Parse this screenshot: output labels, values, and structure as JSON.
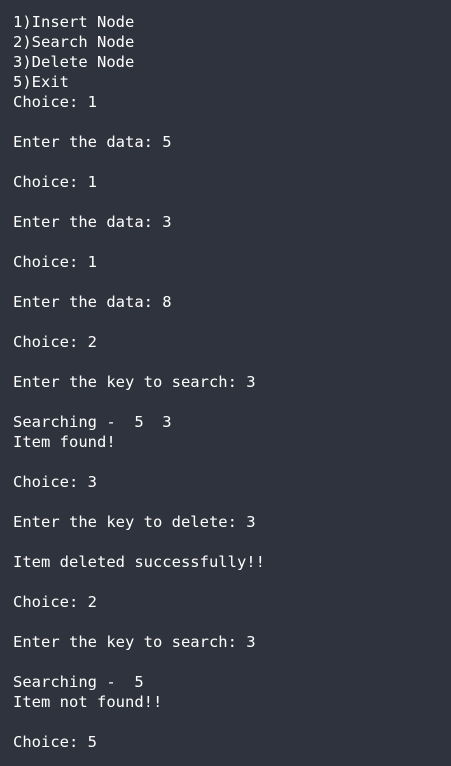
{
  "terminal": {
    "lines": [
      "1)Insert Node",
      "2)Search Node",
      "3)Delete Node",
      "5)Exit",
      "Choice: 1",
      "",
      "Enter the data: 5",
      "",
      "Choice: 1",
      "",
      "Enter the data: 3",
      "",
      "Choice: 1",
      "",
      "Enter the data: 8",
      "",
      "Choice: 2",
      "",
      "Enter the key to search: 3",
      "",
      "Searching -  5  3",
      "Item found!",
      "",
      "Choice: 3",
      "",
      "Enter the key to delete: 3",
      "",
      "Item deleted successfully!!",
      "",
      "Choice: 2",
      "",
      "Enter the key to search: 3",
      "",
      "Searching -  5",
      "Item not found!!",
      "",
      "Choice: 5"
    ]
  }
}
